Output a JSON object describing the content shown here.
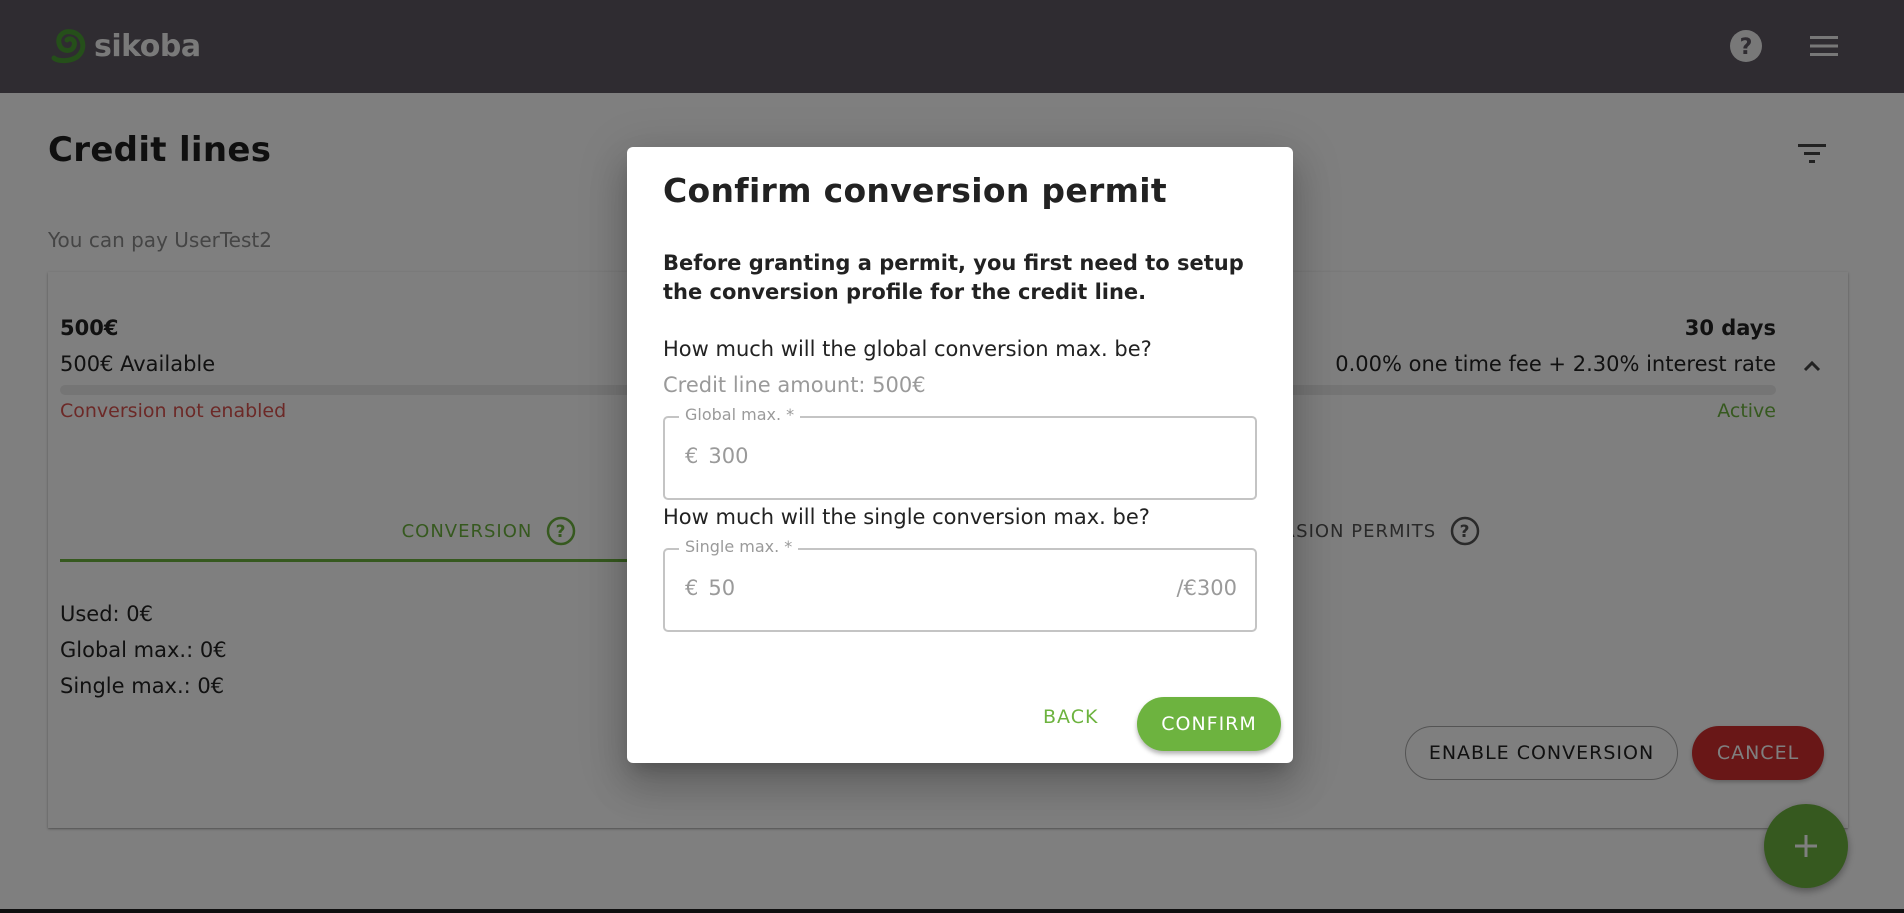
{
  "app": {
    "brand": "sikoba",
    "colors": {
      "appbar": "#5e5863",
      "primary": "#6db33f",
      "danger": "#d32f2f",
      "error_text": "#d9534f"
    },
    "icons": {
      "help": "help-circle-icon",
      "menu": "hamburger-menu-icon"
    }
  },
  "page": {
    "title": "Credit lines",
    "filter_icon": "filter-icon",
    "subtitle": "You can pay UserTest2"
  },
  "credit_line": {
    "amount": "500€",
    "available": "500€ Available",
    "term": "30 days",
    "fees": "0.00% one time fee + 2.30% interest rate",
    "used_fraction": 0,
    "conversion_status": "Conversion not enabled",
    "status": "Active",
    "tabs": [
      {
        "label": "CONVERSION",
        "active": true
      },
      {
        "label": "CONVERSION PERMITS",
        "active": false
      }
    ],
    "stats": {
      "used": "Used: 0€",
      "global_max": "Global max.: 0€",
      "single_max": "Single max.: 0€"
    },
    "actions": {
      "enable_conversion": "ENABLE CONVERSION",
      "cancel": "CANCEL"
    }
  },
  "fab": {
    "icon": "plus-icon"
  },
  "dialog": {
    "title": "Confirm conversion permit",
    "intro": "Before granting a permit, you first need to setup the conversion profile for the credit line.",
    "global_question": "How much will the global conversion max. be?",
    "global_hint": "Credit line amount: 500€",
    "global_field": {
      "label": "Global max. *",
      "prefix": "€",
      "placeholder": "300",
      "value": ""
    },
    "single_question": "How much will the single conversion max. be?",
    "single_field": {
      "label": "Single max. *",
      "prefix": "€",
      "placeholder": "50",
      "value": "",
      "suffix": "/€300"
    },
    "back_label": "BACK",
    "confirm_label": "CONFIRM"
  }
}
